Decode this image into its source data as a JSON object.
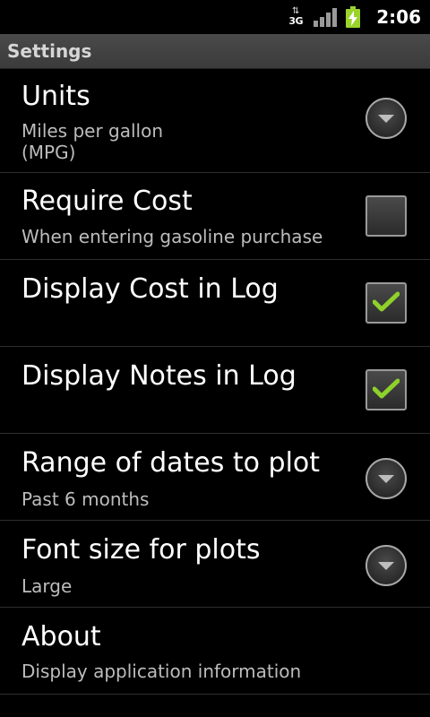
{
  "status_bar": {
    "network_type": "3G",
    "time": "2:06",
    "icons": [
      "data-arrows-icon",
      "signal-icon",
      "battery-charging-icon"
    ],
    "battery_color": "#9bd32d"
  },
  "title_bar": {
    "title": "Settings"
  },
  "preferences": [
    {
      "title": "Units",
      "summary": "Miles per gallon\n(MPG)",
      "widget": "dropdown"
    },
    {
      "title": "Require Cost",
      "summary": "When entering gasoline purchase",
      "widget": "checkbox",
      "checked": false
    },
    {
      "title": "Display Cost in Log",
      "summary": "",
      "widget": "checkbox",
      "checked": true
    },
    {
      "title": "Display Notes in Log",
      "summary": "",
      "widget": "checkbox",
      "checked": true
    },
    {
      "title": "Range of dates to plot",
      "summary": "Past 6 months",
      "widget": "dropdown"
    },
    {
      "title": "Font size for plots",
      "summary": "Large",
      "widget": "dropdown"
    },
    {
      "title": "About",
      "summary": "Display application information",
      "widget": "none"
    }
  ],
  "colors": {
    "check_green": "#8ed12b",
    "background": "#000000",
    "summary_text": "#bcbcbc"
  }
}
